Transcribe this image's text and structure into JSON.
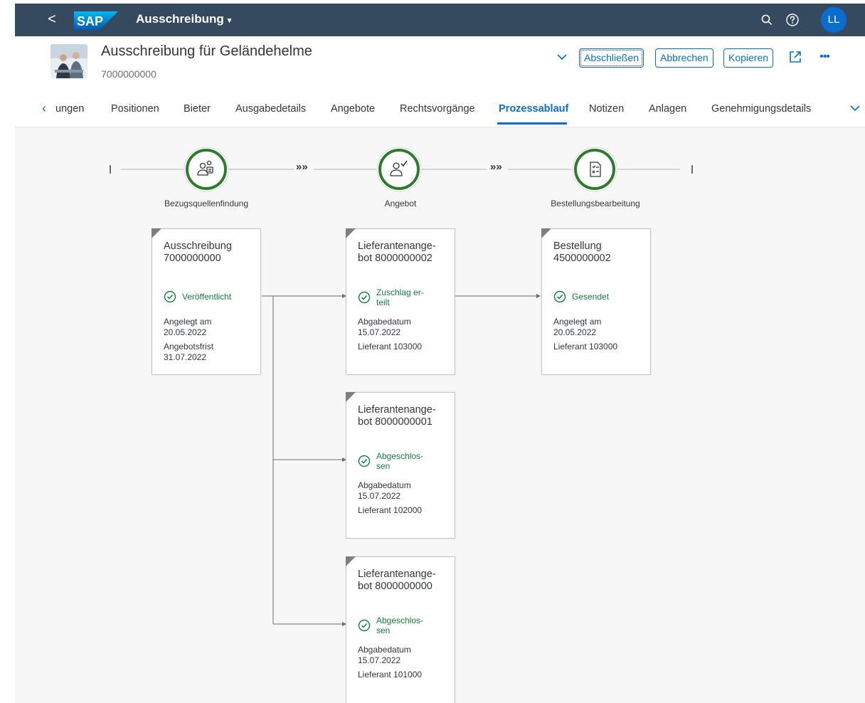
{
  "shell": {
    "back_glyph": "<",
    "logo_text": "SAP",
    "app_title": "Ausschreibung",
    "title_caret": "▾",
    "avatar_initials": "LL",
    "icons": [
      "back-icon",
      "search-icon",
      "help-icon"
    ],
    "bar_color": "#354a5f",
    "avatar_color": "#0a6ed1"
  },
  "header": {
    "title": "Ausschreibung für Geländehelme",
    "subtitle": "7000000000",
    "actions": {
      "finish": "Abschließen",
      "cancel": "Abbrechen",
      "copy": "Kopieren"
    },
    "more_glyph": "•••"
  },
  "tabs": {
    "overflow_left_glyph": "‹",
    "items": [
      {
        "label": "ungen"
      },
      {
        "label": "Positionen"
      },
      {
        "label": "Bieter"
      },
      {
        "label": "Ausgabedetails"
      },
      {
        "label": "Angebote"
      },
      {
        "label": "Rechtsvorgänge"
      },
      {
        "label": "Prozessablauf"
      },
      {
        "label": "Notizen"
      },
      {
        "label": "Anlagen"
      },
      {
        "label": "Genehmigungsdetails"
      }
    ],
    "active": "Prozessablauf"
  },
  "process": {
    "stages": [
      {
        "label": "Bezugsquellenfindung",
        "icon": "supplier-search-icon"
      },
      {
        "label": "Angebot",
        "icon": "quote-check-icon"
      },
      {
        "label": "Bestellungsbearbeitung",
        "icon": "order-document-icon"
      }
    ],
    "connector_glyph": "»»",
    "status_color": "#107e3e",
    "nodes": [
      {
        "title_l1": "Ausschreibung",
        "title_l2": "7000000000",
        "status_l1": "Veröffentlicht",
        "status_l2": "",
        "meta": [
          "Angelegt am",
          "20.05.2022",
          "Angebotsfrist",
          "31.07.2022"
        ]
      },
      {
        "title_l1": "Lieferantenange-",
        "title_l2": "bot 8000000002",
        "status_l1": "Zuschlag er-",
        "status_l2": "teilt",
        "meta": [
          "Abgabedatum",
          "15.07.2022",
          "Lieferant 103000"
        ]
      },
      {
        "title_l1": "Bestellung",
        "title_l2": "4500000002",
        "status_l1": "Gesendet",
        "status_l2": "",
        "meta": [
          "Angelegt am",
          "20.05.2022",
          "Lieferant 103000"
        ]
      },
      {
        "title_l1": "Lieferantenange-",
        "title_l2": "bot 8000000001",
        "status_l1": "Abgeschlos-",
        "status_l2": "sen",
        "meta": [
          "Abgabedatum",
          "15.07.2022",
          "Lieferant 102000"
        ]
      },
      {
        "title_l1": "Lieferantenange-",
        "title_l2": "bot 8000000000",
        "status_l1": "Abgeschlos-",
        "status_l2": "sen",
        "meta": [
          "Abgabedatum",
          "15.07.2022",
          "Lieferant 101000"
        ]
      }
    ]
  }
}
